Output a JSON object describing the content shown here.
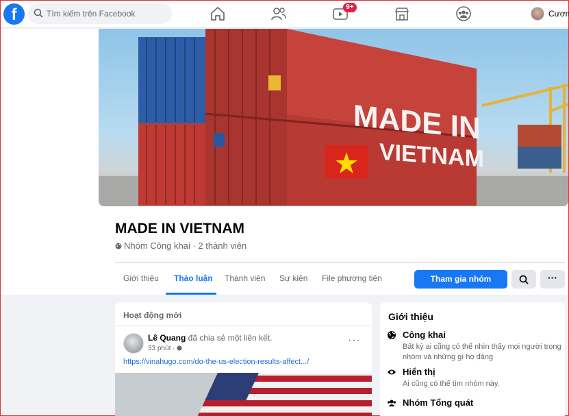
{
  "topbar": {
    "logo": "f",
    "search_placeholder": "Tìm kiếm trên Facebook",
    "watch_badge": "9+",
    "user_name": "Cương"
  },
  "cover": {
    "text_top": "MADE IN",
    "text_bottom": "VIETNAM"
  },
  "group": {
    "title": "MADE IN VIETNAM",
    "subtitle": "Nhóm Công khai · 2 thành viên"
  },
  "tabs": [
    {
      "label": "Giới thiệu"
    },
    {
      "label": "Thảo luận"
    },
    {
      "label": "Thành viên"
    },
    {
      "label": "Sự kiện"
    },
    {
      "label": "File phương tiện"
    }
  ],
  "actions": {
    "join_label": "Tham gia nhóm",
    "more_label": "···"
  },
  "feed": {
    "section_label": "Hoạt động mới",
    "post": {
      "author": "Lê Quang",
      "action": " đã chia sẻ một liên kết.",
      "time": "33 phút · ",
      "more": "···",
      "link": "https://vinahugo.com/do-the-us-election-results-affect.../"
    }
  },
  "about": {
    "title": "Giới thiệu",
    "items": [
      {
        "title": "Công khai",
        "desc": "Bất kỳ ai cũng có thể nhìn thấy mọi người trong nhóm và những gì họ đăng"
      },
      {
        "title": "Hiển thị",
        "desc": "Ai cũng có thể tìm nhóm này."
      },
      {
        "title": "Nhóm Tổng quát",
        "desc": ""
      }
    ]
  },
  "colors": {
    "primary": "#1877f2",
    "badge": "#e41e3f",
    "container_red": "#c23b33",
    "container_blue": "#2f5fa8"
  }
}
